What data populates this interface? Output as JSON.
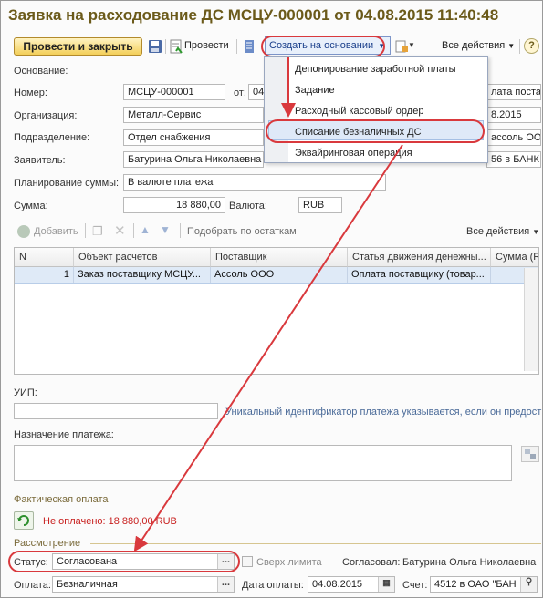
{
  "window": {
    "title": "Заявка на расходование ДС МСЦУ-000001 от 04.08.2015 11:40:48"
  },
  "toolbar": {
    "post_close": "Провести и закрыть",
    "post": "Провести",
    "create_based": "Создать на основании",
    "all_actions": "Все действия",
    "help": "?"
  },
  "create_menu": {
    "items": [
      "Депонирование заработной платы",
      "Задание",
      "Расходный кассовый ордер",
      "Списание безналичных ДС",
      "Эквайринговая операция"
    ],
    "selected_index": 3
  },
  "form": {
    "osnovanie_label": "Основание:",
    "nomer_label": "Номер:",
    "nomer_value": "МСЦУ-000001",
    "ot_label": "от:",
    "ot_value": "04.",
    "org_label": "Организация:",
    "org_value": "Металл-Сервис",
    "podr_label": "Подразделение:",
    "podr_value": "Отдел снабжения",
    "zayav_label": "Заявитель:",
    "zayav_value": "Батурина Ольга Николаевна",
    "plan_label": "Планирование суммы:",
    "plan_value": "В валюте платежа",
    "summa_label": "Сумма:",
    "summa_value": "18 880,00",
    "valuta_label": "Валюта:",
    "valuta_value": "RUB",
    "right_col_1": "лата постав",
    "right_col_2": "8.2015",
    "right_col_3": "ассоль ООО",
    "right_col_4": "56 в БАНК \""
  },
  "table_bar": {
    "add": "Добавить",
    "pick": "Подобрать по остаткам",
    "all_actions": "Все действия"
  },
  "table": {
    "headers": [
      "N",
      "Объект расчетов",
      "Поставщик",
      "Статья движения денежны...",
      "Сумма (RU"
    ],
    "rows": [
      [
        "1",
        "Заказ поставщику МСЦУ...",
        "Ассоль ООО",
        "Оплата поставщику (товар...",
        ""
      ]
    ]
  },
  "uip": {
    "label": "УИП:",
    "hint": "Уникальный идентификатор платежа указывается, если он предост"
  },
  "purpose": {
    "label": "Назначение платежа:"
  },
  "fact": {
    "section": "Фактическая оплата",
    "status": "Не оплачено: 18 880,00 RUB"
  },
  "review": {
    "section": "Рассмотрение",
    "status_label": "Статус:",
    "status_value": "Согласована",
    "over_limit": "Сверх лимита",
    "approved_label": "Согласовал:",
    "approved_value": "Батурина Ольга Николаевна"
  },
  "bottom": {
    "oplata_label": "Оплата:",
    "oplata_value": "Безналичная",
    "date_label": "Дата оплаты:",
    "date_value": "04.08.2015",
    "schet_label": "Счет:",
    "schet_value": "4512 в ОАО \"БАН"
  },
  "colors": {
    "title": "#6b5a1a",
    "accent_red": "#d9393d",
    "selection_blue": "#dfe9f8",
    "status_red": "#c8201f",
    "section_brown": "#7a6a3a"
  }
}
